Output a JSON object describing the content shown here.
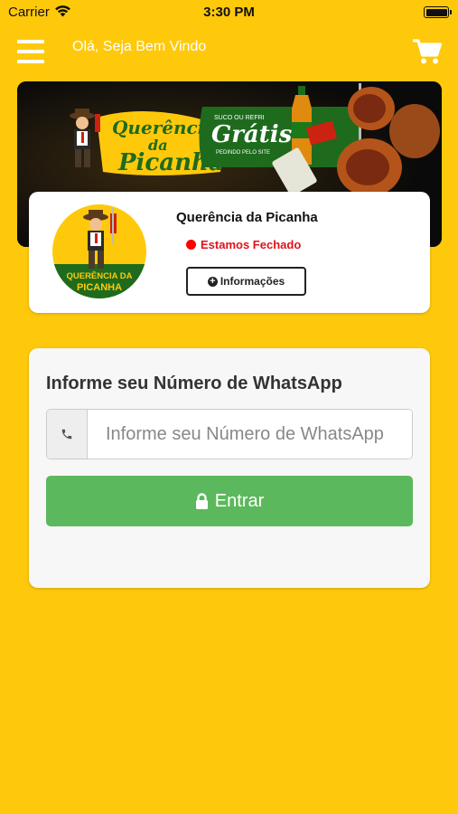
{
  "status_bar": {
    "carrier": "Carrier",
    "time": "3:30 PM"
  },
  "header": {
    "welcome": "Olá, Seja Bem Vindo",
    "menu_icon": "hamburger-menu-icon",
    "cart_icon": "shopping-cart-icon"
  },
  "banner": {
    "brand_line1": "Querência",
    "brand_line2": "da",
    "brand_line3": "Picanha",
    "promo_top": "SUCO OU REFRI",
    "promo_main": "Grátis",
    "promo_bottom": "PEDINDO PELO SITE"
  },
  "store": {
    "name": "Querência da Picanha",
    "status": "Estamos Fechado",
    "info_button": "Informações",
    "logo_line1": "QUERÊNCIA DA",
    "logo_line2": "PICANHA"
  },
  "login": {
    "title": "Informe seu Número de WhatsApp",
    "phone_placeholder": "Informe seu Número de WhatsApp",
    "phone_value": "",
    "enter_button": "Entrar"
  },
  "colors": {
    "background": "#FFC90B",
    "button_green": "#5cb85c",
    "status_red": "#e0121c",
    "banner_green": "#1e6b1e"
  }
}
